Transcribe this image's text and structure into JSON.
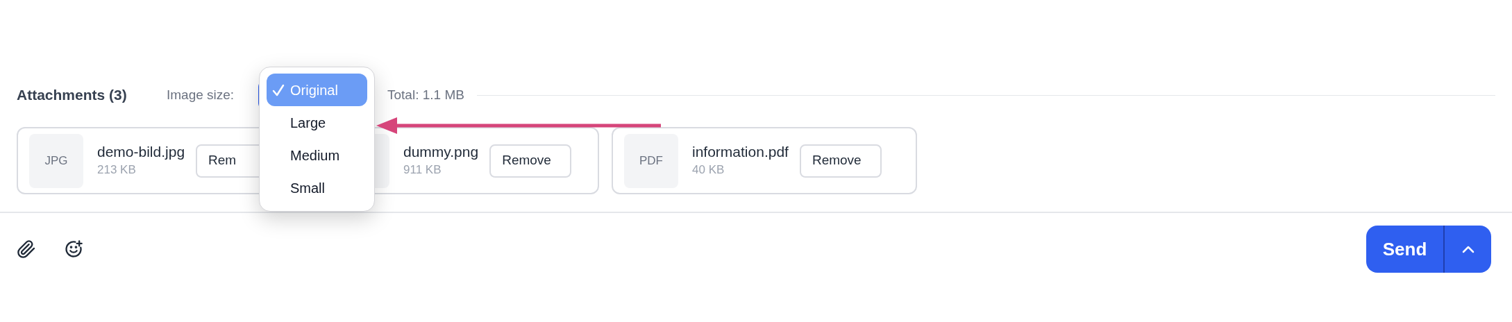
{
  "attachments": {
    "title": "Attachments (3)",
    "image_size_label": "Image size:",
    "total": "Total: 1.1 MB",
    "files": [
      {
        "type": "JPG",
        "name": "demo-bild.jpg",
        "size": "213 KB",
        "action": "Rem"
      },
      {
        "name": "dummy.png",
        "size": "911 KB",
        "action": "Remove"
      },
      {
        "type": "PDF",
        "name": "information.pdf",
        "size": "40 KB",
        "action": "Remove"
      }
    ]
  },
  "image_size_menu": {
    "options": [
      {
        "label": "Original",
        "selected": true
      },
      {
        "label": "Large",
        "selected": false
      },
      {
        "label": "Medium",
        "selected": false
      },
      {
        "label": "Small",
        "selected": false
      }
    ]
  },
  "composer": {
    "send": "Send"
  }
}
